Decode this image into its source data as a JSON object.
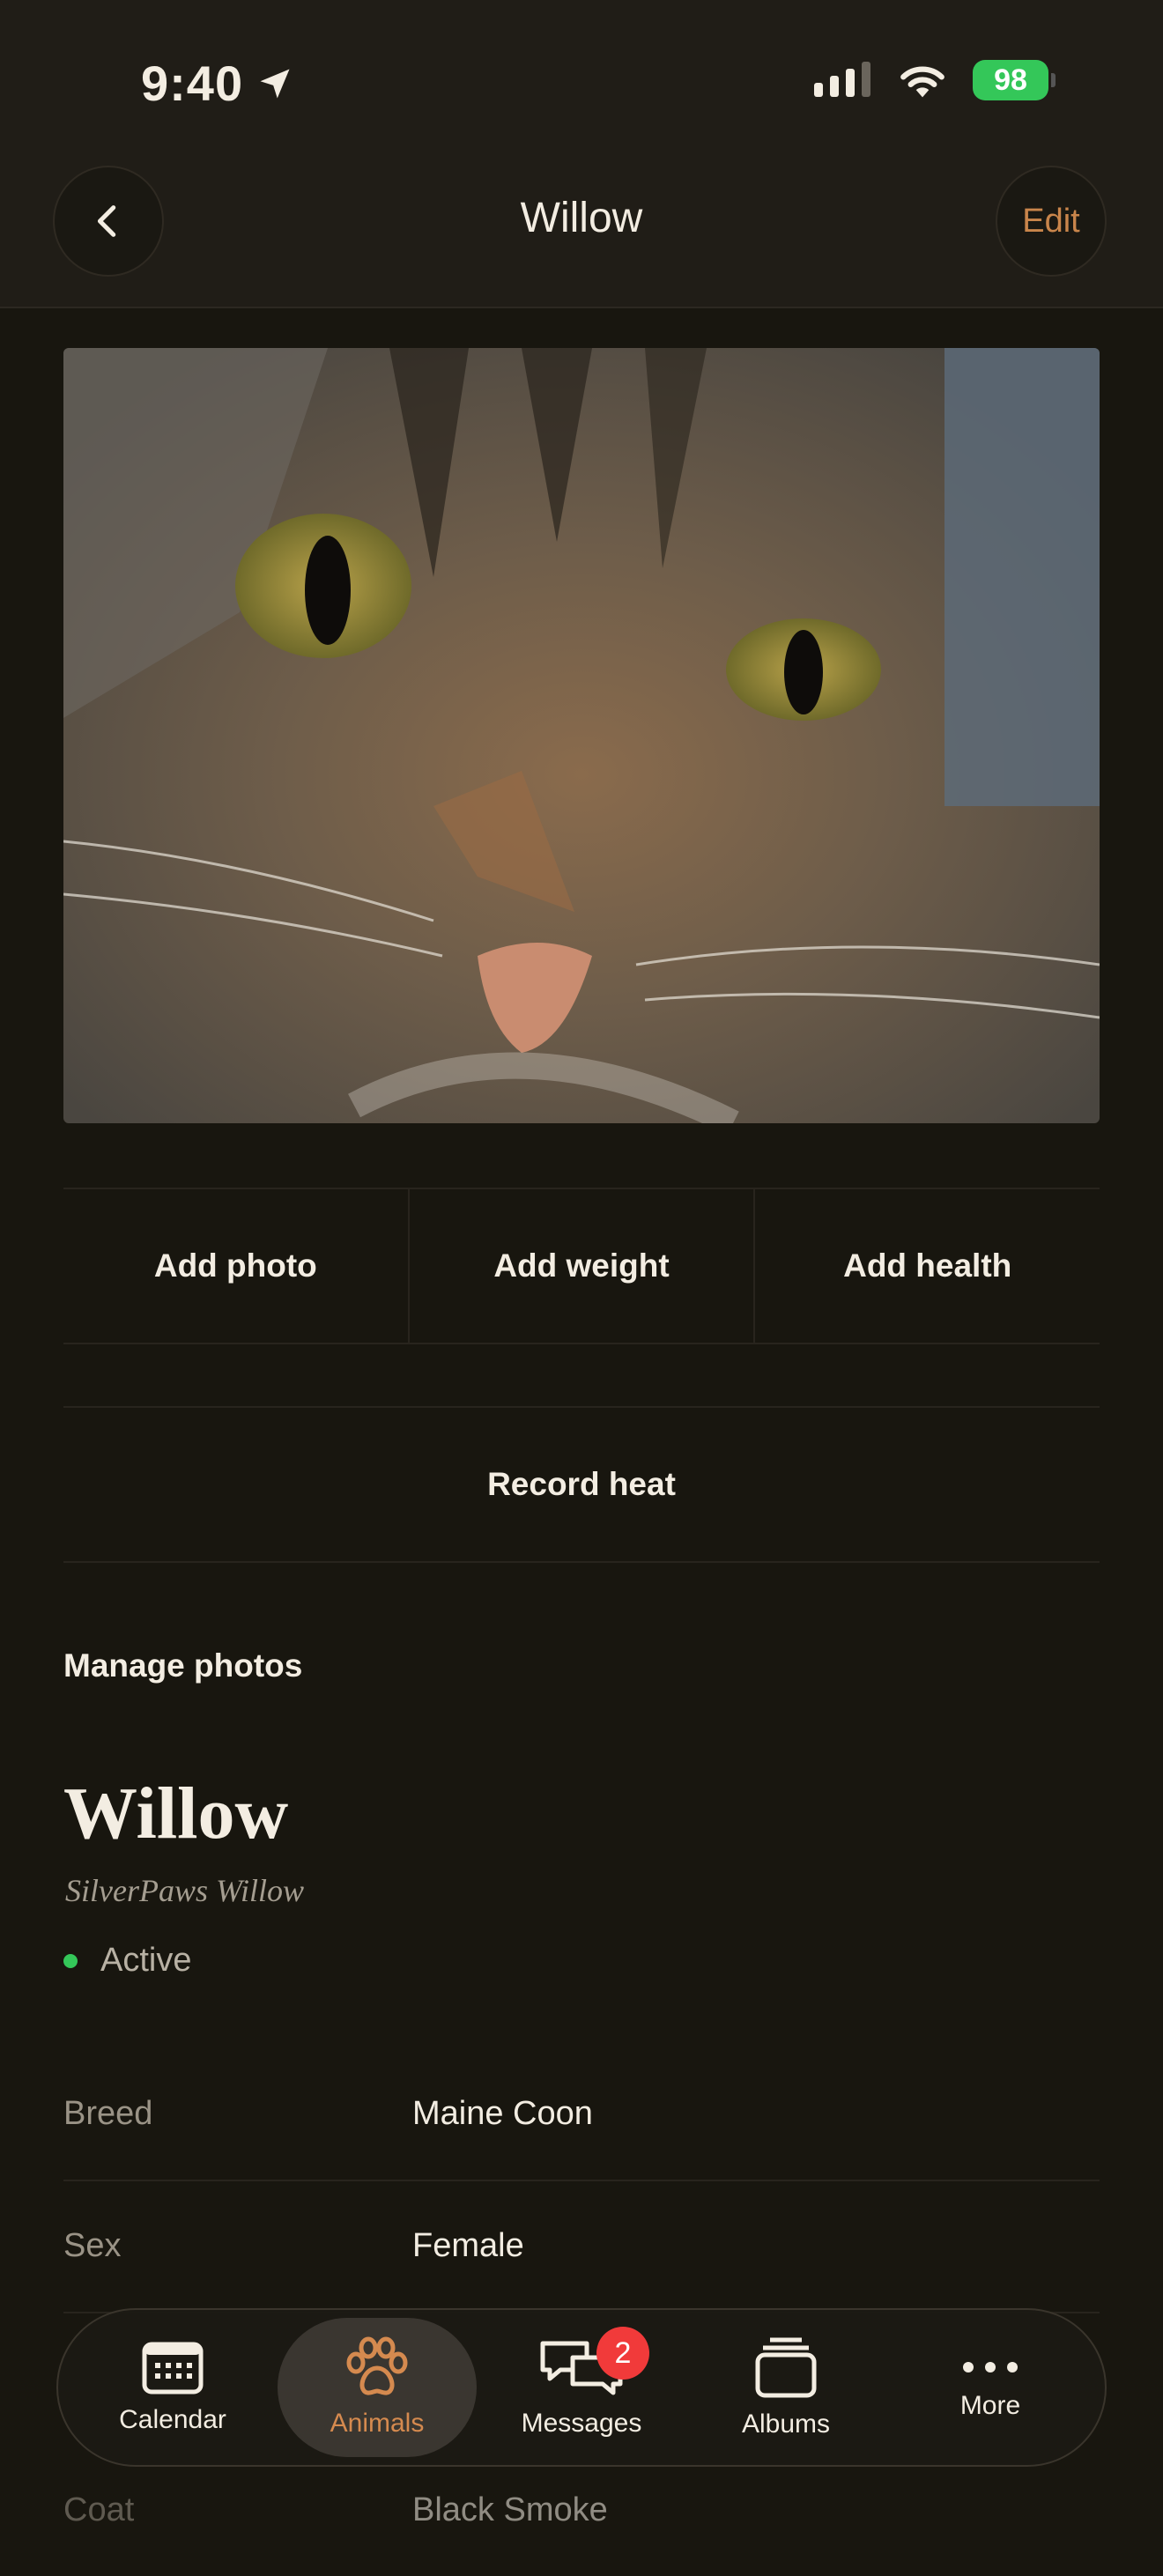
{
  "status_bar": {
    "time": "9:40",
    "battery": "98"
  },
  "nav": {
    "title": "Willow",
    "edit_label": "Edit"
  },
  "actions": {
    "add_photo": "Add photo",
    "add_weight": "Add weight",
    "add_health": "Add health",
    "record_heat": "Record heat"
  },
  "manage_photos": "Manage photos",
  "animal": {
    "name": "Willow",
    "registered_name": "SilverPaws Willow",
    "status": "Active"
  },
  "details": [
    {
      "label": "Breed",
      "value": "Maine Coon"
    },
    {
      "label": "Sex",
      "value": "Female"
    },
    {
      "label": "Coat",
      "value": "Black Smoke"
    }
  ],
  "tabs": [
    {
      "label": "Calendar",
      "icon": "calendar-icon"
    },
    {
      "label": "Animals",
      "icon": "paw-icon"
    },
    {
      "label": "Messages",
      "icon": "messages-icon",
      "badge": "2"
    },
    {
      "label": "Albums",
      "icon": "albums-icon"
    },
    {
      "label": "More",
      "icon": "more-icon"
    }
  ],
  "colors": {
    "accent": "#d58a4f",
    "background": "#18160f",
    "active_dot": "#34c759",
    "badge": "#f13a3a"
  }
}
